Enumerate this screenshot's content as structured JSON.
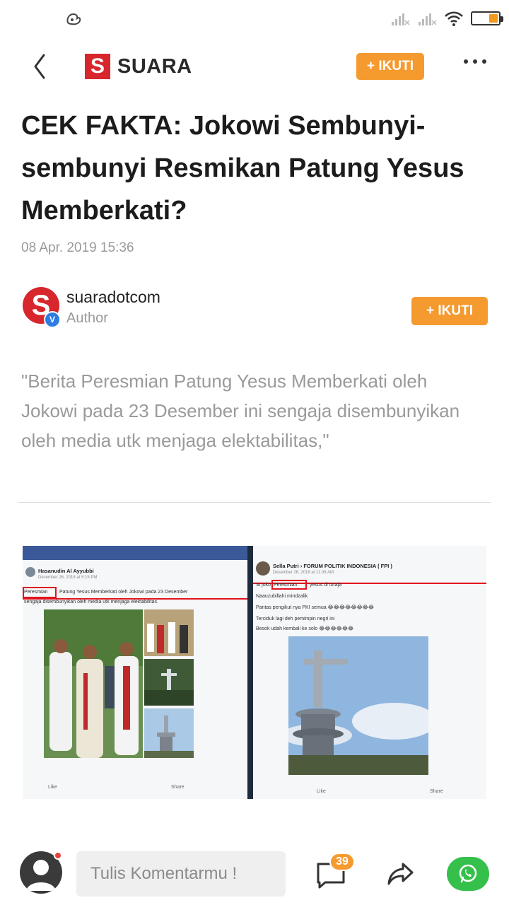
{
  "header": {
    "brand_logo_letter": "S",
    "brand_name": "SUARA",
    "follow_label": "+ IKUTI",
    "icons": [
      "back-icon",
      "more-icon"
    ]
  },
  "article": {
    "title": "CEK FAKTA: Jokowi Sembunyi-sembunyi Resmikan Patung Yesus Memberkati?",
    "date": "08 Apr. 2019 15:36",
    "quote": "\"Berita Peresmian Patung Yesus Memberkati oleh Jokowi pada 23 Desember ini sengaja disembunyikan oleh media utk menjaga elektabilitas,\""
  },
  "author": {
    "avatar_letter": "S",
    "verified_badge": "V",
    "name": "suaradotcom",
    "role": "Author",
    "follow_label": "+ IKUTI"
  },
  "figure": {
    "left_post": {
      "name": "Hasanudin Al Ayyubbi",
      "meta": "December 26, 2018 at 5:15 PM",
      "highlight": "Peresmian",
      "line1": "Patung Yesus Memberkati oleh Jokowi pada 23 Desember",
      "line2": "sengaja disembunyikan oleh media utk menjaga elektabilitas.",
      "like": "Like",
      "share": "Share"
    },
    "right_post": {
      "name": "Sella Putri › FORUM POLITIK INDONESIA ( FPI )",
      "meta": "Desember 26, 2018 at 11:08 AM",
      "highlight": "Peresmian",
      "line1_pre": "Si joko",
      "line1_post": "yesus di toraja",
      "line2": "Naauzubillahi mindzalik",
      "line3": "Pantas pengikut nya PKI semua 😂😂😂😂😂😂😂😂",
      "line4": "Terciduk lagi deh pemimpin negri ini",
      "line5": "Besok udah kembali ke solo 😂😂😂😂😂😂",
      "like": "Like",
      "share": "Share"
    }
  },
  "bottom_bar": {
    "comment_placeholder": "Tulis Komentarmu !",
    "comment_count": "39",
    "icons": [
      "user-avatar-icon",
      "comment-icon",
      "share-icon",
      "whatsapp-icon"
    ]
  },
  "colors": {
    "accent": "#f59a2e",
    "brand_red": "#d7262c",
    "verified_blue": "#2f7ce0",
    "whatsapp_green": "#35c04c"
  }
}
